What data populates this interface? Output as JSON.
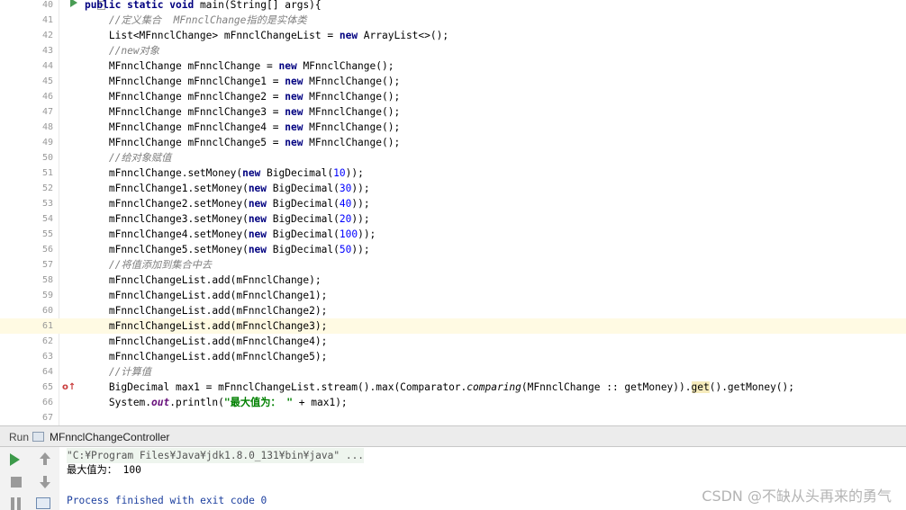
{
  "editor": {
    "line_numbers": [
      "40",
      "41",
      "42",
      "43",
      "44",
      "45",
      "46",
      "47",
      "48",
      "49",
      "50",
      "51",
      "52",
      "53",
      "54",
      "55",
      "56",
      "57",
      "58",
      "59",
      "60",
      "61",
      "62",
      "63",
      "64",
      "65",
      "66",
      "67"
    ],
    "lines": [
      [
        {
          "t": "    "
        },
        {
          "t": "public static void",
          "c": "kw"
        },
        {
          "t": " main(String[] args){"
        }
      ],
      [
        {
          "t": "        "
        },
        {
          "t": "//定义集合  MFnnclChange指的是实体类",
          "c": "cmt"
        }
      ],
      [
        {
          "t": "        List<MFnnclChange> mFnnclChangeList = "
        },
        {
          "t": "new",
          "c": "kw"
        },
        {
          "t": " ArrayList<>();"
        }
      ],
      [
        {
          "t": "        "
        },
        {
          "t": "//new对象",
          "c": "cmt"
        }
      ],
      [
        {
          "t": "        MFnnclChange mFnnclChange = "
        },
        {
          "t": "new",
          "c": "kw"
        },
        {
          "t": " MFnnclChange();"
        }
      ],
      [
        {
          "t": "        MFnnclChange mFnnclChange1 = "
        },
        {
          "t": "new",
          "c": "kw"
        },
        {
          "t": " MFnnclChange();"
        }
      ],
      [
        {
          "t": "        MFnnclChange mFnnclChange2 = "
        },
        {
          "t": "new",
          "c": "kw"
        },
        {
          "t": " MFnnclChange();"
        }
      ],
      [
        {
          "t": "        MFnnclChange mFnnclChange3 = "
        },
        {
          "t": "new",
          "c": "kw"
        },
        {
          "t": " MFnnclChange();"
        }
      ],
      [
        {
          "t": "        MFnnclChange mFnnclChange4 = "
        },
        {
          "t": "new",
          "c": "kw"
        },
        {
          "t": " MFnnclChange();"
        }
      ],
      [
        {
          "t": "        MFnnclChange mFnnclChange5 = "
        },
        {
          "t": "new",
          "c": "kw"
        },
        {
          "t": " MFnnclChange();"
        }
      ],
      [
        {
          "t": "        "
        },
        {
          "t": "//给对象赋值",
          "c": "cmt"
        }
      ],
      [
        {
          "t": "        mFnnclChange.setMoney("
        },
        {
          "t": "new",
          "c": "kw"
        },
        {
          "t": " BigDecimal("
        },
        {
          "t": "10",
          "c": "num-lit"
        },
        {
          "t": "));"
        }
      ],
      [
        {
          "t": "        mFnnclChange1.setMoney("
        },
        {
          "t": "new",
          "c": "kw"
        },
        {
          "t": " BigDecimal("
        },
        {
          "t": "30",
          "c": "num-lit"
        },
        {
          "t": "));"
        }
      ],
      [
        {
          "t": "        mFnnclChange2.setMoney("
        },
        {
          "t": "new",
          "c": "kw"
        },
        {
          "t": " BigDecimal("
        },
        {
          "t": "40",
          "c": "num-lit"
        },
        {
          "t": "));"
        }
      ],
      [
        {
          "t": "        mFnnclChange3.setMoney("
        },
        {
          "t": "new",
          "c": "kw"
        },
        {
          "t": " BigDecimal("
        },
        {
          "t": "20",
          "c": "num-lit"
        },
        {
          "t": "));"
        }
      ],
      [
        {
          "t": "        mFnnclChange4.setMoney("
        },
        {
          "t": "new",
          "c": "kw"
        },
        {
          "t": " BigDecimal("
        },
        {
          "t": "100",
          "c": "num-lit"
        },
        {
          "t": "));"
        }
      ],
      [
        {
          "t": "        mFnnclChange5.setMoney("
        },
        {
          "t": "new",
          "c": "kw"
        },
        {
          "t": " BigDecimal("
        },
        {
          "t": "50",
          "c": "num-lit"
        },
        {
          "t": "));"
        }
      ],
      [
        {
          "t": "        "
        },
        {
          "t": "//将值添加到集合中去",
          "c": "cmt"
        }
      ],
      [
        {
          "t": "        mFnnclChangeList.add(mFnnclChange);"
        }
      ],
      [
        {
          "t": "        mFnnclChangeList.add(mFnnclChange1);"
        }
      ],
      [
        {
          "t": "        mFnnclChangeList.add(mFnnclChange2);"
        }
      ],
      [
        {
          "t": "        mFnnclChangeList.add(mFnnclChange3);"
        }
      ],
      [
        {
          "t": "        mFnnclChangeList.add(mFnnclChange4);"
        }
      ],
      [
        {
          "t": "        mFnnclChangeList.add(mFnnclChange5);"
        }
      ],
      [
        {
          "t": "        "
        },
        {
          "t": "//计算值",
          "c": "cmt"
        }
      ],
      [
        {
          "t": "        BigDecimal max1 = mFnnclChangeList.stream().max(Comparator."
        },
        {
          "t": "comparing",
          "c": "stat"
        },
        {
          "t": "(MFnnclChange :: getMoney))."
        },
        {
          "t": "get",
          "c": "gethl"
        },
        {
          "t": "().getMoney();"
        }
      ],
      [
        {
          "t": "        System."
        },
        {
          "t": "out",
          "c": "fld"
        },
        {
          "t": ".println("
        },
        {
          "t": "\"最大值为： \"",
          "c": "str"
        },
        {
          "t": " + max1);"
        }
      ],
      [
        {
          "t": ""
        }
      ]
    ],
    "highlighted_line": "61",
    "run_marker_line": "40",
    "override_marker_line": "65",
    "override_marker_glyph": "o↑"
  },
  "run_panel": {
    "label": "Run",
    "config_name": "MFnnclChangeController"
  },
  "console": {
    "command": "\"C:¥Program Files¥Java¥jdk1.8.0_131¥bin¥java\" ...",
    "output": "最大值为： 100",
    "exit_message": "Process finished with exit code 0"
  },
  "watermark": "CSDN @不缺从头再来的勇气",
  "colors": {
    "keyword": "#000080",
    "comment": "#808080",
    "string": "#008000",
    "number": "#0000ff",
    "current_line": "#fffae3",
    "run_icon": "#3c9a4a"
  },
  "icons": [
    "run-gutter-icon",
    "fold-icon",
    "override-icon",
    "config-icon",
    "rerun-icon",
    "stop-icon",
    "pause-icon",
    "scroll-up-icon",
    "scroll-down-icon",
    "layout-icon"
  ]
}
